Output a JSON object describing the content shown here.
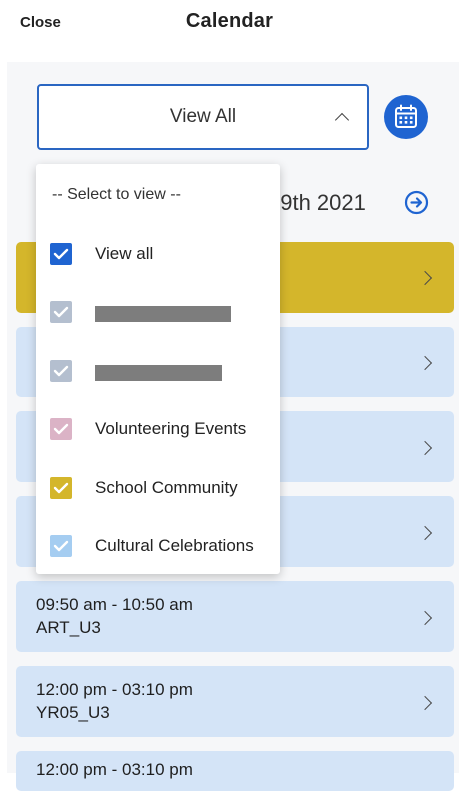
{
  "header": {
    "close_label": "Close",
    "title": "Calendar"
  },
  "filter": {
    "selected": "View All"
  },
  "date_nav": {
    "date_text": "19th 2021"
  },
  "dropdown": {
    "header": "-- Select to view --",
    "options": [
      {
        "label": "View all",
        "color": "#1f64d1",
        "checked": true
      },
      {
        "label": "",
        "color": "#b4bfcf",
        "checked": true,
        "redacted": true
      },
      {
        "label": "",
        "color": "#b4bfcf",
        "checked": true,
        "redacted": true
      },
      {
        "label": "Volunteering Events",
        "color": "#dbb3c6",
        "checked": true
      },
      {
        "label": "School Community",
        "color": "#d4b62b",
        "checked": true
      },
      {
        "label": "Cultural Celebrations",
        "color": "#a5cdf1",
        "checked": true
      }
    ]
  },
  "events": [
    {
      "time": "",
      "name": "",
      "color": "#d4b62b"
    },
    {
      "time": "",
      "name": "",
      "color": "#d4e4f7"
    },
    {
      "time": "",
      "name": "",
      "color": "#d4e4f7"
    },
    {
      "time": "",
      "name": "",
      "color": "#d4e4f7"
    },
    {
      "time": "",
      "name": "",
      "color": "#d4e4f7"
    },
    {
      "time": "09:50 am - 10:50 am",
      "name": "ART_U3",
      "color": "#d4e4f7"
    },
    {
      "time": "12:00 pm - 03:10 pm",
      "name": "YR05_U3",
      "color": "#d4e4f7"
    },
    {
      "time": "12:00 pm - 03:10 pm",
      "name": "",
      "color": "#d4e4f7"
    }
  ],
  "colors": {
    "accent": "#1f64d1",
    "border": "#2a66c2",
    "event_blue": "#d4e4f7",
    "event_yellow": "#d4b62b"
  }
}
